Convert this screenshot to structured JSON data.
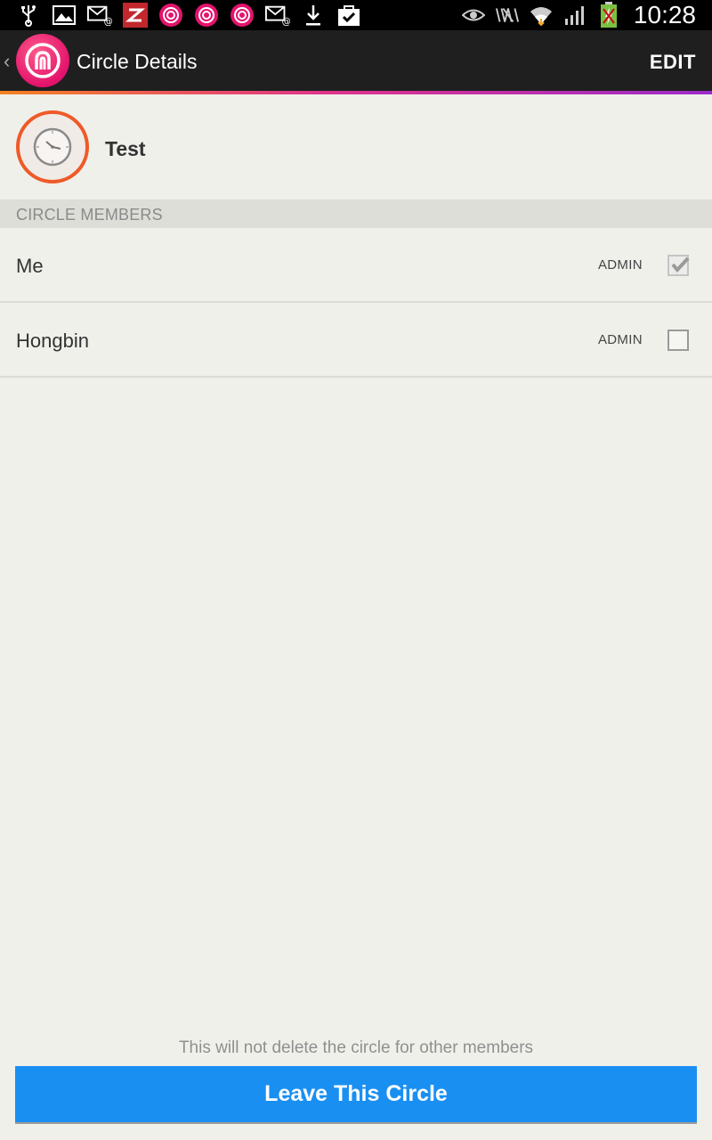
{
  "status_bar": {
    "time": "10:28",
    "left_icons": [
      "usb-icon",
      "image-icon",
      "email-at-icon",
      "zinio-icon",
      "life360-icon",
      "life360-icon",
      "life360-icon",
      "email-at-icon",
      "download-icon",
      "bag-check-icon"
    ],
    "right_icons": [
      "eye-icon",
      "nfc-vibrate-icon",
      "wifi-icon",
      "signal-icon",
      "battery-charging-icon"
    ]
  },
  "action_bar": {
    "title": "Circle Details",
    "edit_label": "EDIT",
    "accent_colors": [
      "#f58220",
      "#e0348a",
      "#9b2bc9"
    ]
  },
  "circle": {
    "name": "Test",
    "avatar_icon": "clock-icon",
    "ring_color": "#ef5a28"
  },
  "members_section": {
    "header": "CIRCLE MEMBERS",
    "members": [
      {
        "name": "Me",
        "role_label": "ADMIN",
        "admin": true
      },
      {
        "name": "Hongbin",
        "role_label": "ADMIN",
        "admin": false
      }
    ]
  },
  "footer": {
    "note": "This will not delete the circle for other members",
    "leave_button_label": "Leave This Circle",
    "button_color": "#1a8ff2"
  }
}
